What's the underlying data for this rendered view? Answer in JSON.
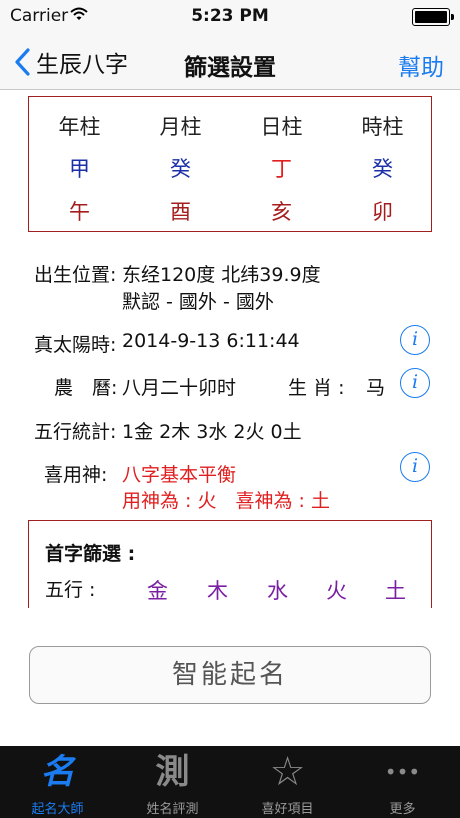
{
  "status_bar": {
    "carrier": "Carrier",
    "time": "5:23 PM"
  },
  "nav": {
    "back_label": "生辰八字",
    "title": "篩選設置",
    "help_label": "幫助"
  },
  "bazi": {
    "columns": [
      {
        "header": "年柱",
        "stem": "甲",
        "branch": "午",
        "stem_color": "#1b2fa8"
      },
      {
        "header": "月柱",
        "stem": "癸",
        "branch": "酉",
        "stem_color": "#1b2fa8"
      },
      {
        "header": "日柱",
        "stem": "丁",
        "branch": "亥",
        "stem_color": "#e02020"
      },
      {
        "header": "時柱",
        "stem": "癸",
        "branch": "卯",
        "stem_color": "#1b2fa8"
      }
    ]
  },
  "birth_place": {
    "label": "出生位置:",
    "line1": "东经120度 北纬39.9度",
    "line2": "默認 - 國外 - 國外"
  },
  "solar_time": {
    "label": "真太陽時:",
    "value": "2014-9-13 6:11:44"
  },
  "lunar": {
    "label": "農　曆:",
    "value": "八月二十卯时",
    "zodiac_label": "生 肖 : ",
    "zodiac_value": "马"
  },
  "wuxing_stats": {
    "label": "五行統計:",
    "value": "1金 2木 3水 2火 0土"
  },
  "favorable": {
    "label": "喜用神:",
    "line1": "八字基本平衡",
    "line2": "用神為 : 火　喜神為 : 土"
  },
  "first_char": {
    "title": "首字篩選 :",
    "wuxing_label": "五行 :",
    "elements": [
      "金",
      "木",
      "水",
      "火",
      "土"
    ]
  },
  "smart_button": {
    "label": "智能起名"
  },
  "tabs": [
    {
      "icon_glyph": "名",
      "label": "起名大師",
      "active": true
    },
    {
      "icon_glyph": "測",
      "label": "姓名評測",
      "active": false
    },
    {
      "icon_glyph": "☆",
      "label": "喜好項目",
      "active": false
    },
    {
      "icon_glyph": "•••",
      "label": "更多",
      "active": false
    }
  ],
  "colors": {
    "accent": "#1a7cf0",
    "box_border": "#a02020",
    "highlight_red": "#e02020",
    "element_purple": "#7b1fa2"
  }
}
